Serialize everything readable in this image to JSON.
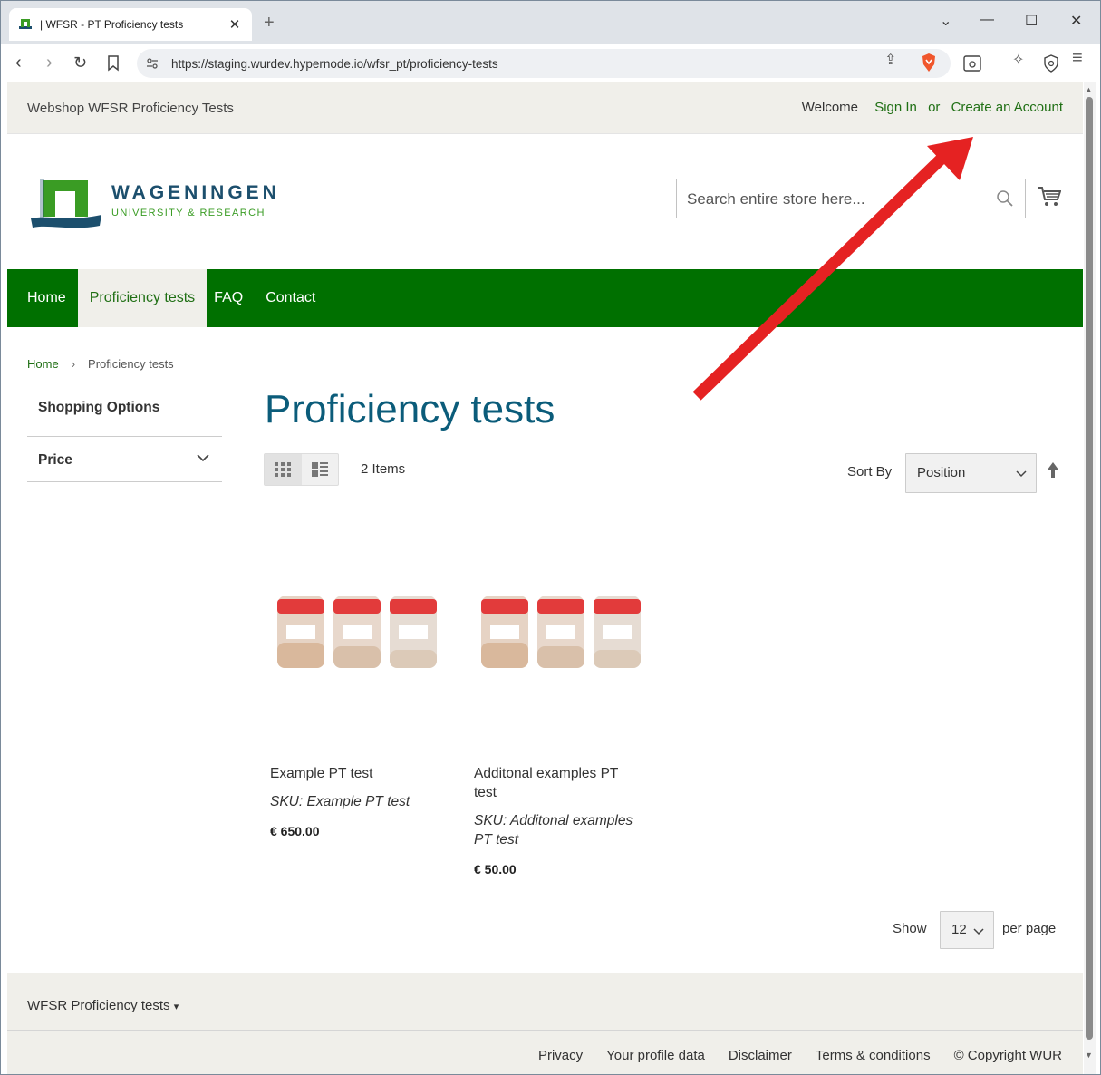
{
  "browser": {
    "tab_title": "| WFSR - PT Proficiency tests",
    "url": "https://staging.wurdev.hypernode.io/wfsr_pt/proficiency-tests"
  },
  "header": {
    "shop_name": "Webshop WFSR Proficiency Tests",
    "welcome": "Welcome",
    "sign_in": "Sign In",
    "or": "or",
    "create_account": "Create an Account"
  },
  "logo": {
    "name": "WAGENINGEN",
    "subtitle": "UNIVERSITY & RESEARCH"
  },
  "search": {
    "placeholder": "Search entire store here..."
  },
  "nav": {
    "items": [
      "Home",
      "Proficiency tests",
      "FAQ",
      "Contact"
    ],
    "active_index": 1
  },
  "breadcrumb": {
    "home": "Home",
    "separator": "›",
    "current": "Proficiency tests"
  },
  "sidebar": {
    "title": "Shopping Options",
    "filter_label": "Price"
  },
  "main": {
    "title": "Proficiency tests",
    "items_count": "2 Items",
    "sort_label": "Sort By",
    "sort_value": "Position",
    "show_label": "Show",
    "limit_value": "12",
    "per_page_label": "per page"
  },
  "products": [
    {
      "name": "Example PT test",
      "sku": "SKU: Example PT test",
      "price": "€ 650.00"
    },
    {
      "name": "Additonal examples PT test",
      "sku": "SKU: Additonal examples PT test",
      "price": "€ 50.00"
    }
  ],
  "footer": {
    "title": "WFSR Proficiency tests",
    "links": [
      "Privacy",
      "Your profile data",
      "Disclaimer",
      "Terms & conditions",
      "© Copyright WUR"
    ]
  },
  "colors": {
    "brand_green": "#007000",
    "link_green": "#1f6f14",
    "title_blue": "#0b5c7a",
    "panel_beige": "#f0efea",
    "annotation_red": "#e52222"
  }
}
